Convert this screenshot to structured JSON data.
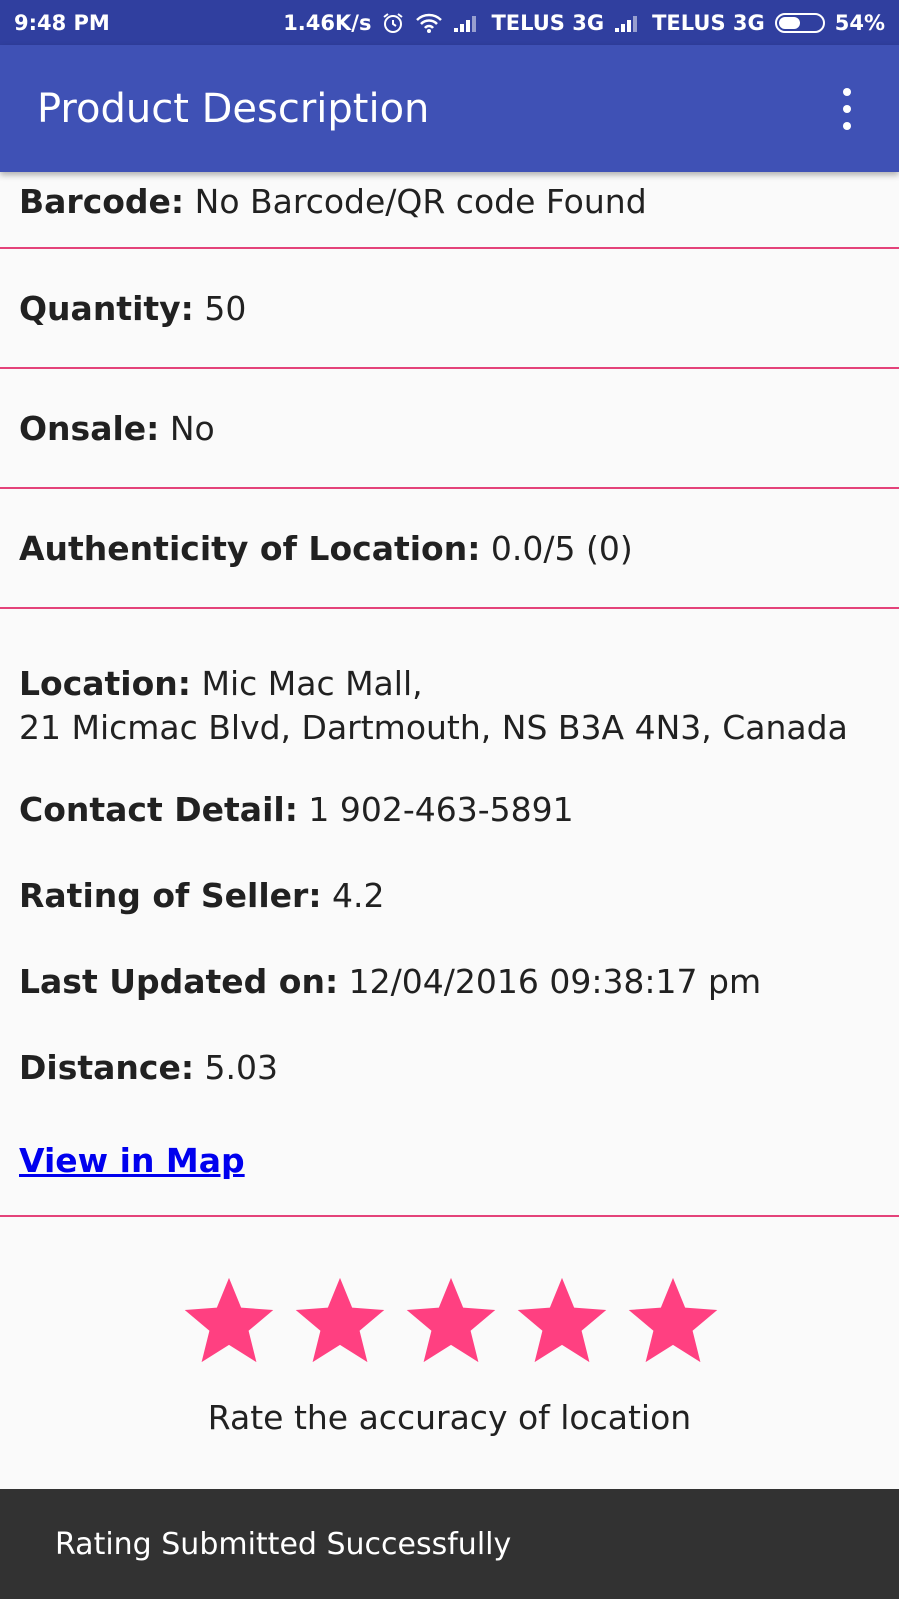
{
  "status_bar": {
    "time": "9:48 PM",
    "speed": "1.46K/s",
    "carrier1": "TELUS 3G",
    "carrier2": "TELUS 3G",
    "battery": "54%",
    "battery_level": 0.54
  },
  "app_bar": {
    "title": "Product Description"
  },
  "details": {
    "barcode_label": "Barcode:",
    "barcode_value": "No Barcode/QR code Found",
    "quantity_label": "Quantity:",
    "quantity_value": "50",
    "onsale_label": "Onsale:",
    "onsale_value": "No",
    "authenticity_label": "Authenticity of Location:",
    "authenticity_value": "0.0/5 (0)",
    "location_label": "Location:",
    "location_line1": "Mic Mac Mall,",
    "location_line2": "21 Micmac Blvd, Dartmouth, NS B3A 4N3, Canada",
    "contact_label": "Contact Detail:",
    "contact_value": "1 902-463-5891",
    "rating_label": "Rating of Seller:",
    "rating_value": "4.2",
    "updated_label": "Last Updated on:",
    "updated_value": "12/04/2016 09:38:17 pm",
    "distance_label": "Distance:",
    "distance_value": "5.03",
    "map_link": "View in Map"
  },
  "rating": {
    "stars_filled": 5,
    "stars_total": 5,
    "star_color": "#ff4081",
    "caption": "Rate the accuracy of location"
  },
  "snackbar": {
    "message": "Rating Submitted Successfully"
  },
  "colors": {
    "status_bar": "#303f9f",
    "app_bar": "#3f51b5",
    "divider": "#e4437a",
    "link": "#0000ee"
  }
}
